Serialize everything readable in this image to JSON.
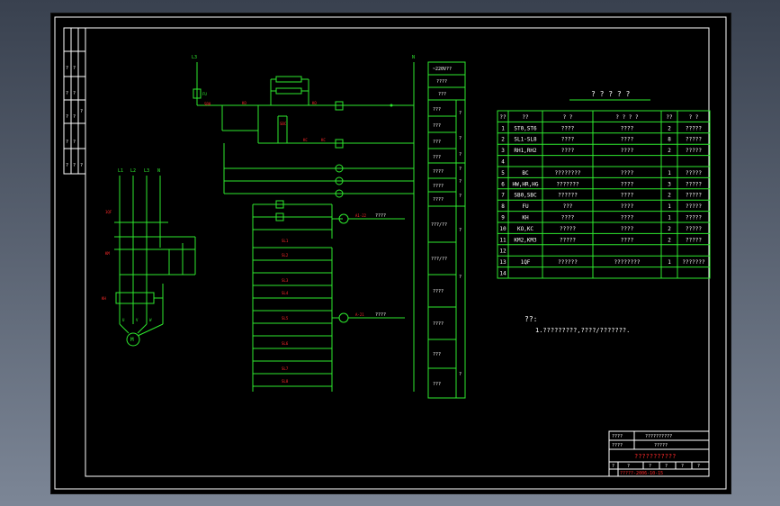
{
  "legend": {
    "title": "? ? ? ? ?",
    "headers": [
      "??",
      "??",
      "? ?",
      "? ? ? ?",
      "??",
      "? ?"
    ],
    "rows": [
      [
        "1",
        "ST0,ST6",
        "????",
        "????",
        "2",
        "?????"
      ],
      [
        "2",
        "SL1-SL8",
        "????",
        "????",
        "8",
        "?????"
      ],
      [
        "3",
        "RH1,RH2",
        "????",
        "????",
        "2",
        "?????"
      ],
      [
        "4",
        "",
        "",
        "",
        "",
        ""
      ],
      [
        "5",
        "BC",
        "????????",
        "????",
        "1",
        "?????"
      ],
      [
        "6",
        "HW,HR,HG",
        "???????",
        "????",
        "3",
        "?????"
      ],
      [
        "7",
        "SB0,SBC",
        "??????",
        "????",
        "2",
        "?????"
      ],
      [
        "8",
        "FU",
        "???",
        "????",
        "1",
        "?????"
      ],
      [
        "9",
        "KH",
        "????",
        "????",
        "1",
        "?????"
      ],
      [
        "10",
        "KO,KC",
        "?????",
        "????",
        "2",
        "?????"
      ],
      [
        "11",
        "KM2,KM3",
        "?????",
        "????",
        "2",
        "?????"
      ],
      [
        "12",
        "",
        "",
        "",
        "",
        ""
      ],
      [
        "13",
        "1QF",
        "??????",
        "????????",
        "1",
        "???????"
      ],
      [
        "14",
        "",
        "",
        "",
        "",
        ""
      ]
    ]
  },
  "notes": {
    "heading": "??:",
    "line1": "1.?????????,????/???????."
  },
  "function_column": {
    "cells": [
      "~220V??",
      "????",
      "???",
      "???",
      "???",
      "???",
      "???",
      "????",
      "????",
      "????",
      "???/??",
      "???/??",
      "????",
      "????",
      "???",
      "???"
    ],
    "side_marks": [
      "?",
      "?",
      "?",
      "?",
      "?",
      "?",
      "?",
      "?",
      "?"
    ]
  },
  "circuit_labels": {
    "top_left": "L3",
    "top_right": "N",
    "fuse": "FU",
    "terminal_a": "A1-22",
    "terminal_a_text": "????",
    "terminal_b": "A-21",
    "terminal_b_text": "????",
    "phases": [
      "L1",
      "L2",
      "L3",
      "N"
    ],
    "breaker": "1QF",
    "contactor": "KM",
    "relay": "KH",
    "motor": "M",
    "motor_phases": [
      "U",
      "V",
      "W"
    ],
    "contacts": [
      "SB0",
      "KO",
      "SBC",
      "KC",
      "KO",
      "KC",
      "SL1",
      "SL2",
      "SL3",
      "SL4",
      "SL5",
      "SL6",
      "SL7",
      "SL8"
    ]
  },
  "title_block": {
    "r1_label": "????",
    "r1_value": "??????????",
    "r2_label": "????",
    "r2_value": "?????",
    "project": "???????????",
    "row4": [
      "?",
      "?",
      "?",
      "?",
      "?",
      "?"
    ],
    "drawing_no": "?????-2006-10-15"
  },
  "frame_strip": [
    "?",
    "?",
    "?",
    "?",
    "?",
    "?",
    "?",
    "?",
    "?",
    "?",
    "?",
    "?"
  ]
}
